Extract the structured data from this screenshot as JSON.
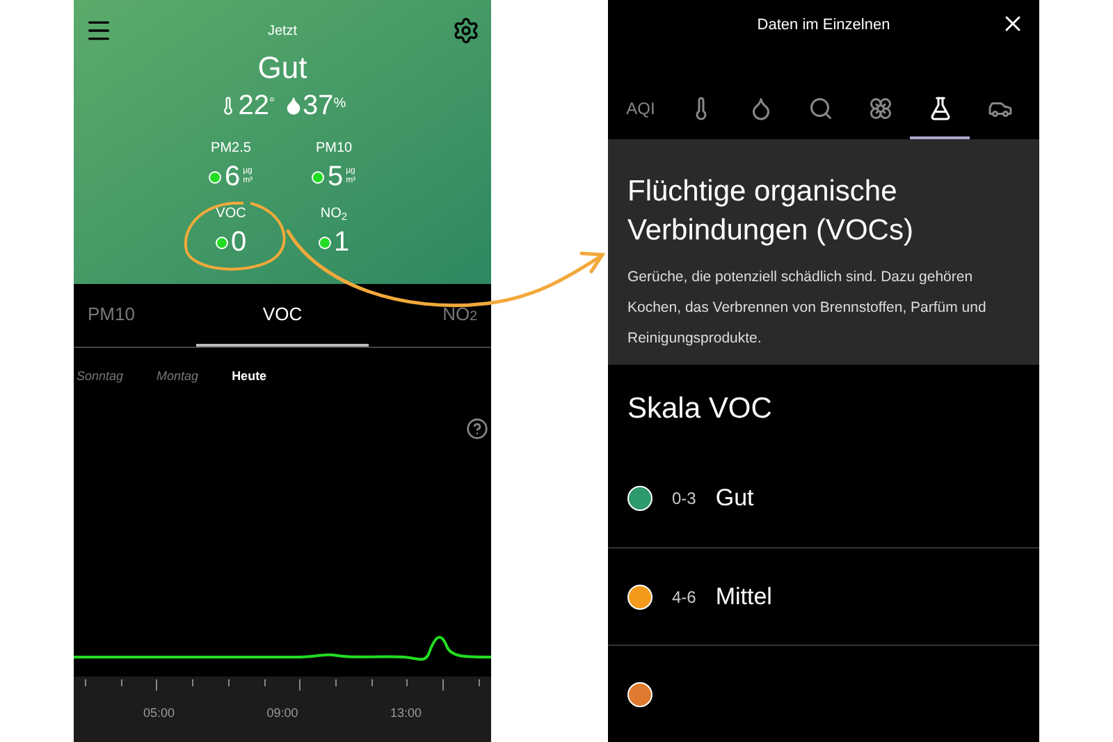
{
  "current": {
    "title": "Jetzt",
    "status": "Gut",
    "temperature": "22",
    "temperature_unit": "°",
    "humidity": "37",
    "humidity_unit": "%",
    "metrics": [
      {
        "label": "PM2.5",
        "value": "6",
        "unit_top": "µg",
        "unit_bottom": "m³"
      },
      {
        "label": "PM10",
        "value": "5",
        "unit_top": "µg",
        "unit_bottom": "m³"
      },
      {
        "label": "VOC",
        "value": "0"
      },
      {
        "label": "NO$_{2}$",
        "value": "1"
      }
    ]
  },
  "pollutant_tabs": [
    {
      "label": "PM10",
      "selected": false
    },
    {
      "label": "VOC",
      "selected": true
    },
    {
      "label": "NO$_{2}$",
      "selected": false
    }
  ],
  "days": [
    {
      "label": "Sonntag",
      "selected": false
    },
    {
      "label": "Montag",
      "selected": false
    },
    {
      "label": "Heute",
      "selected": true
    }
  ],
  "time_axis": [
    "05:00",
    "09:00",
    "13:00"
  ],
  "details": {
    "title": "Daten im Einzelnen",
    "tabs": [
      {
        "kind": "text",
        "label": "AQI",
        "selected": false
      },
      {
        "kind": "icon",
        "selected": false
      },
      {
        "kind": "icon",
        "selected": false
      },
      {
        "kind": "icon",
        "selected": false
      },
      {
        "kind": "icon",
        "selected": false
      },
      {
        "kind": "icon",
        "selected": true
      },
      {
        "kind": "icon",
        "selected": false
      }
    ],
    "heading": "Flüchtige organische Verbindungen (VOCs)",
    "description": "Gerüche, die potenziell schädlich sind. Dazu gehören Kochen, das Verbrennen von Brennstoffen, Parfüm und Reinigungsprodukte.",
    "scale_title": "Skala VOC",
    "levels": [
      {
        "range": "0-3",
        "label": "Gut",
        "color": "#2e9a6c"
      },
      {
        "range": "4-6",
        "label": "Mittel",
        "color": "#f39a1c"
      },
      {
        "color": "#e07a30"
      }
    ]
  }
}
